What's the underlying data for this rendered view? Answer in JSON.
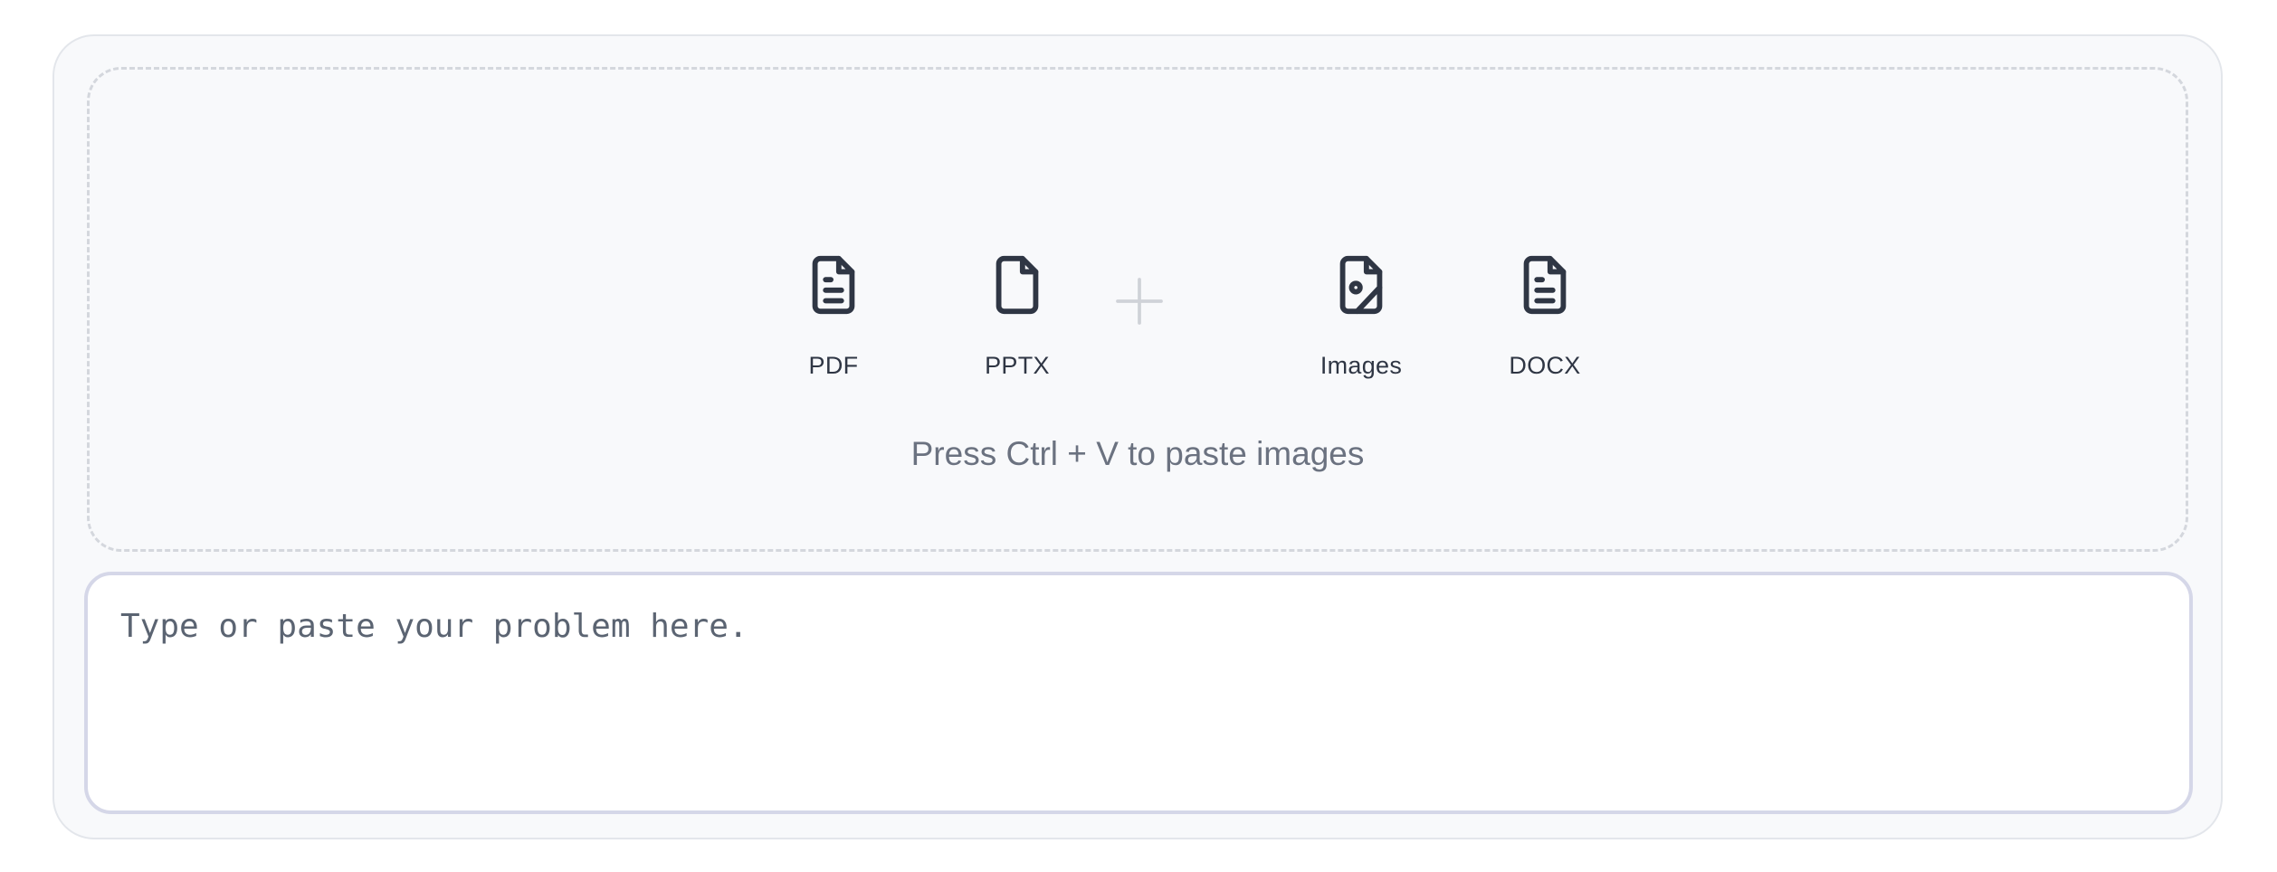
{
  "upload": {
    "file_types": [
      {
        "label": "PDF",
        "icon": "file-text-icon"
      },
      {
        "label": "PPTX",
        "icon": "file-icon"
      },
      {
        "label": "Images",
        "icon": "file-image-icon"
      },
      {
        "label": "DOCX",
        "icon": "file-text-icon"
      }
    ],
    "plus_icon": "plus-icon",
    "hint": "Press Ctrl + V to paste images"
  },
  "input": {
    "placeholder": "Type or paste your problem here.",
    "value": ""
  },
  "colors": {
    "icon": "#2f3644",
    "plus": "#cfd2d8",
    "hint": "#6b7280",
    "focus_border": "#d5d7e8"
  }
}
